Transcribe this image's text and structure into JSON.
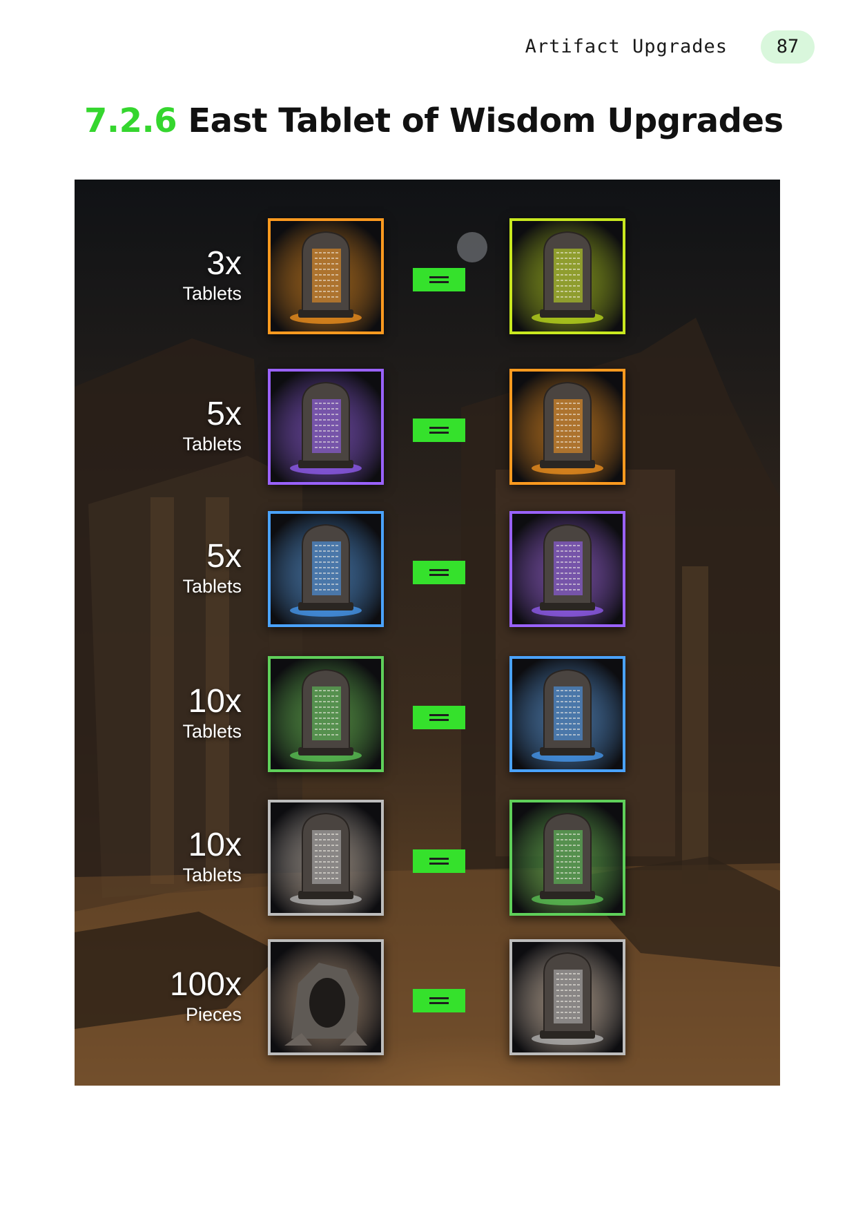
{
  "header": {
    "section_title": "Artifact Upgrades",
    "page_number": "87"
  },
  "heading": {
    "number": "7.2.6",
    "title": "East Tablet of Wisdom Upgrades"
  },
  "rarity_colors": {
    "common": "#bdbdbd",
    "uncommon": "#5fd05a",
    "rare": "#4aa3ff",
    "epic": "#9a62ff",
    "legendary": "#ff9a1f",
    "mythic": "#c9e81f"
  },
  "upgrades": [
    {
      "qty": "3x",
      "unit": "Tablets",
      "from": "legendary",
      "to": "mythic"
    },
    {
      "qty": "5x",
      "unit": "Tablets",
      "from": "epic",
      "to": "legendary"
    },
    {
      "qty": "5x",
      "unit": "Tablets",
      "from": "rare",
      "to": "epic"
    },
    {
      "qty": "10x",
      "unit": "Tablets",
      "from": "uncommon",
      "to": "rare"
    },
    {
      "qty": "10x",
      "unit": "Tablets",
      "from": "common",
      "to": "uncommon"
    },
    {
      "qty": "100x",
      "unit": "Pieces",
      "from": "broken-pieces",
      "to": "common"
    }
  ]
}
